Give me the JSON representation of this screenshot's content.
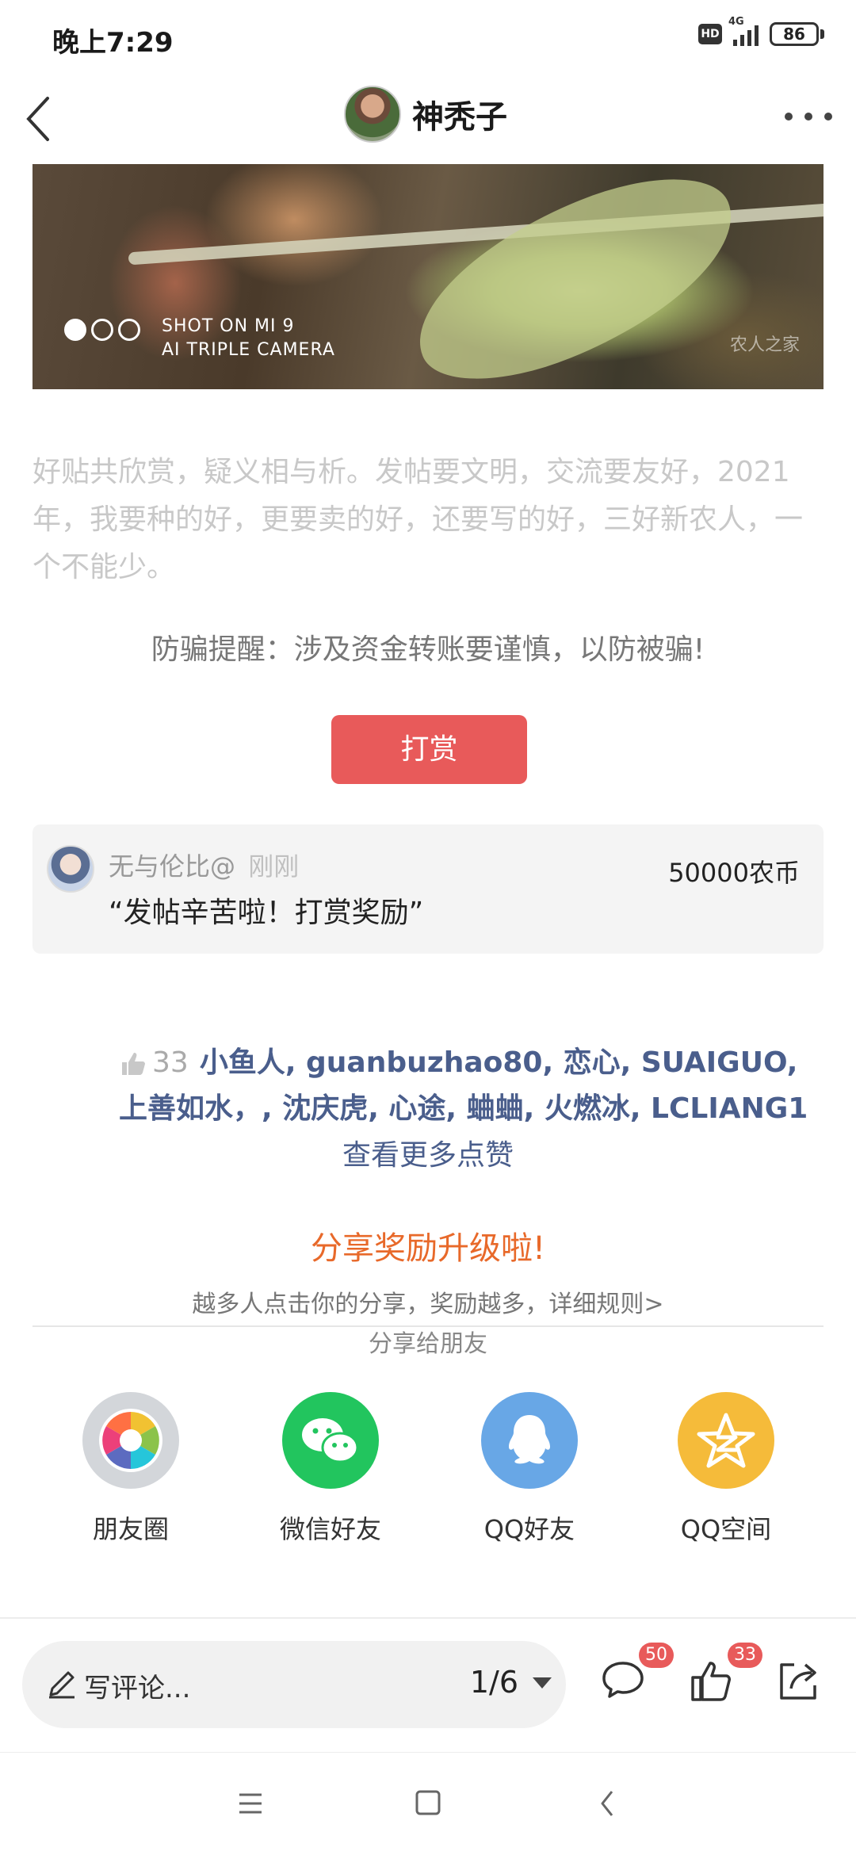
{
  "status_bar": {
    "time": "晚上7:29",
    "hd": "HD",
    "network": "4G",
    "battery": "86"
  },
  "header": {
    "author_name": "神秃子",
    "back_icon": "back-arrow-icon",
    "more_icon": "more-dots-icon"
  },
  "banner": {
    "shot_line1": "SHOT ON MI 9",
    "shot_line2": "AI TRIPLE CAMERA",
    "watermark": "农人之家"
  },
  "post": {
    "text": "好贴共欣赏，疑义相与析。发帖要文明，交流要友好，2021年，我要种的好，更要卖的好，还要写的好，三好新农人，一个不能少。",
    "anti_fraud": "防骗提醒：涉及资金转账要谨慎，以防被骗!"
  },
  "reward": {
    "button_label": "打赏",
    "user": "无与伦比@",
    "time": "刚刚",
    "amount": "50000农币",
    "message": "“发帖辛苦啦！打赏奖励”"
  },
  "likes": {
    "count": "33",
    "names": "小鱼人, guanbuzhao80, 恋心, SUAIGUO, 上善如水，, 沈庆虎, 心途, 蛐蛐, 火燃冰, LCLIANG1",
    "more_label": "查看更多点赞"
  },
  "share": {
    "title": "分享奖励升级啦!",
    "description": "越多人点击你的分享，奖励越多，详细规则>",
    "divider_label": "分享给朋友",
    "items": [
      {
        "label": "朋友圈",
        "icon": "moments-icon",
        "color": "#d3d6da"
      },
      {
        "label": "微信好友",
        "icon": "wechat-icon",
        "color": "#22c55e"
      },
      {
        "label": "QQ好友",
        "icon": "qq-icon",
        "color": "#68a7e6"
      },
      {
        "label": "QQ空间",
        "icon": "qzone-icon",
        "color": "#f5bb3a"
      }
    ]
  },
  "bottom_bar": {
    "comment_placeholder": "写评论...",
    "page": "1/6",
    "comment_badge": "50",
    "like_badge": "33"
  },
  "colors": {
    "accent_red": "#e85a5a",
    "share_orange": "#e8692a",
    "link_blue": "#4a5e8c"
  }
}
